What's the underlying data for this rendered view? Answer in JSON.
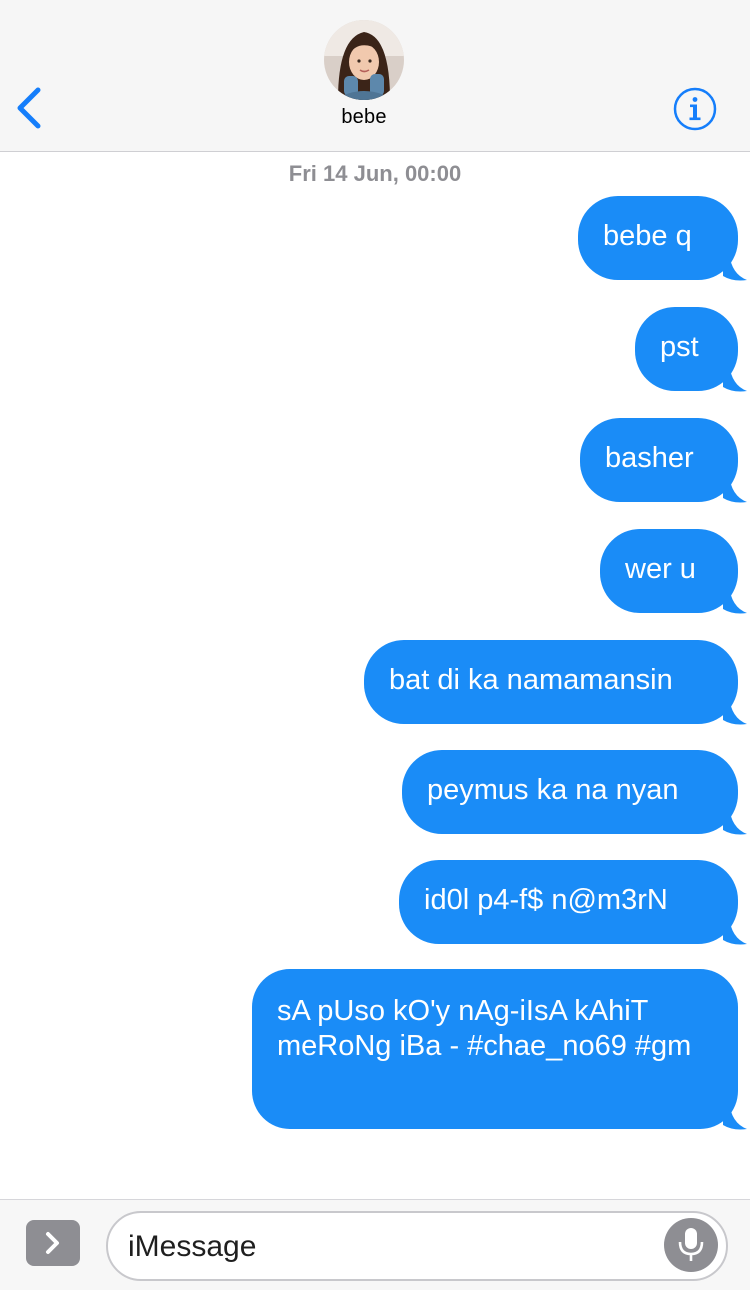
{
  "header": {
    "contact_name": "bebe",
    "back_icon": "chevron-left-icon",
    "info_icon": "info-icon",
    "accent_color": "#157efb"
  },
  "conversation": {
    "timestamp_day": "Fri",
    "timestamp_rest": "14 Jun, 00:00",
    "bubble_color": "#1a8cf7",
    "messages": [
      {
        "sender": "me",
        "text": "bebe q"
      },
      {
        "sender": "me",
        "text": "pst"
      },
      {
        "sender": "me",
        "text": "basher"
      },
      {
        "sender": "me",
        "text": "wer u"
      },
      {
        "sender": "me",
        "text": "bat di ka namamansin"
      },
      {
        "sender": "me",
        "text": "peymus ka na nyan"
      },
      {
        "sender": "me",
        "text": "id0l p4-f$ n@m3rN"
      },
      {
        "sender": "me",
        "text": "sA pUso kO'y nAg-iIsA kAhiT meRoNg iBa - #chae_no69 #gm"
      }
    ]
  },
  "compose": {
    "placeholder": "iMessage",
    "apps_icon": "chevron-right-icon",
    "mic_icon": "microphone-icon"
  }
}
